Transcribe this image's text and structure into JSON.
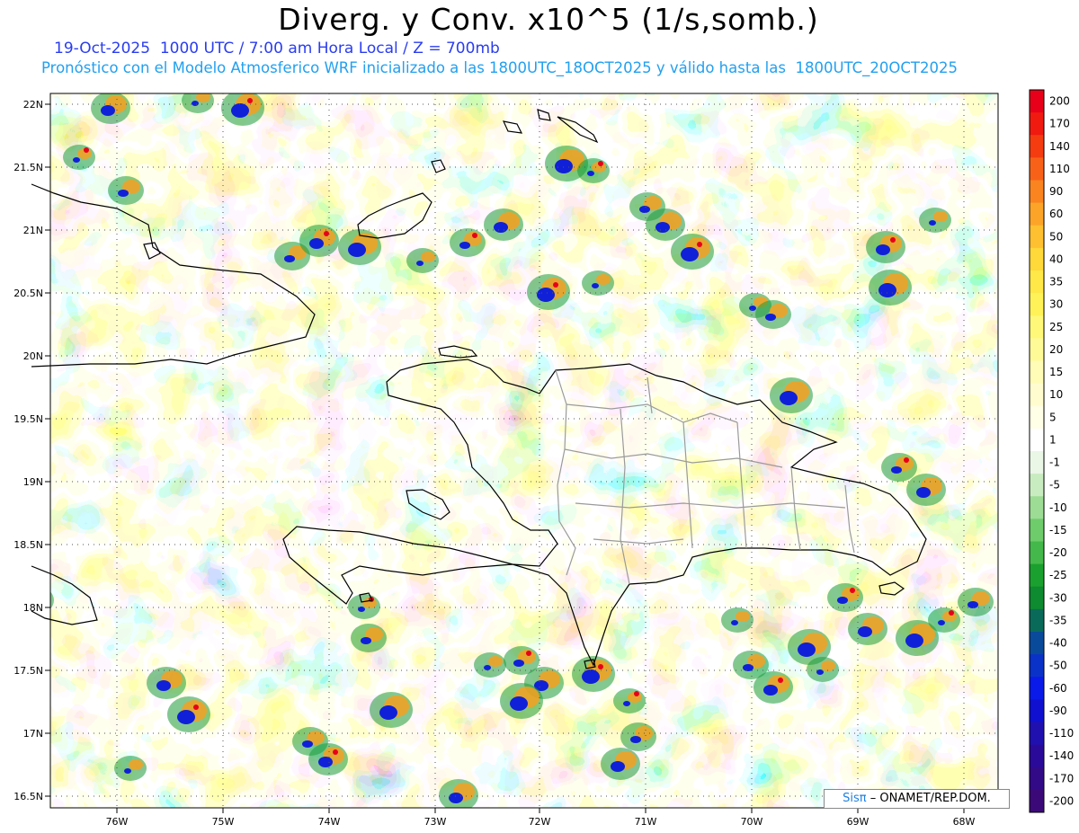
{
  "header": {
    "title": "Diverg. y Conv. x10^5 (1/s,somb.)",
    "line1": "19-Oct-2025  1000 UTC / 7:00 am Hora Local / Z = 700mb",
    "line2": "Pronóstico con el Modelo Atmosferico WRF inicializado a las 1800UTC_18OCT2025 y válido hasta las  1800UTC_20OCT2025"
  },
  "map": {
    "lat_labels": [
      "22N",
      "21.5N",
      "21N",
      "20.5N",
      "20N",
      "19.5N",
      "19N",
      "18.5N",
      "18N",
      "17.5N",
      "17N",
      "16.5N"
    ],
    "lon_labels": [
      "76W",
      "75W",
      "74W",
      "73W",
      "72W",
      "71W",
      "70W",
      "69W",
      "68W"
    ]
  },
  "colorbar": {
    "labels": [
      "200",
      "170",
      "140",
      "110",
      "90",
      "60",
      "50",
      "40",
      "35",
      "30",
      "25",
      "20",
      "15",
      "10",
      "5",
      "1",
      "-1",
      "-5",
      "-10",
      "-15",
      "-20",
      "-25",
      "-30",
      "-35",
      "-40",
      "-50",
      "-60",
      "-90",
      "-110",
      "-140",
      "-170",
      "-200"
    ],
    "colors": [
      "#e8001a",
      "#f01a10",
      "#f43c10",
      "#f86218",
      "#fa8420",
      "#fca428",
      "#fec030",
      "#ffd83a",
      "#ffe848",
      "#fff258",
      "#fff878",
      "#fffa98",
      "#fffcb8",
      "#fffdd0",
      "#fffee6",
      "#ffffff",
      "#eaf6e6",
      "#c8ecc0",
      "#9cdc94",
      "#6ecc6a",
      "#44b84a",
      "#1aa02e",
      "#0e8a30",
      "#0a6a5a",
      "#0a4a9a",
      "#0a32c8",
      "#0a1ae8",
      "#1010d0",
      "#2010b0",
      "#2a0a98",
      "#320a88",
      "#3c0a78"
    ]
  },
  "credit": {
    "sis": "Sisπ",
    "rest": "– ONAMET/REP.DOM."
  }
}
